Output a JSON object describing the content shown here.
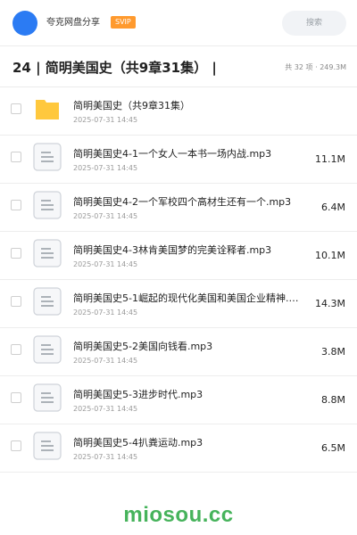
{
  "header": {
    "brand": "夸克网盘分享",
    "badge": "SVIP",
    "search_placeholder": "搜索"
  },
  "title_row": {
    "title": "24 | 简明美国史（共9章31集） |",
    "summary": "共 32 项 · 249.3M"
  },
  "files": [
    {
      "icon": "folder-icon",
      "name": "简明美国史（共9章31集）",
      "date": "2025-07-31 14:45",
      "size": ""
    },
    {
      "icon": "file-audio-icon",
      "name": "简明美国史4-1一个女人一本书一场内战.mp3",
      "date": "2025-07-31 14:45",
      "size": "11.1M"
    },
    {
      "icon": "file-audio-icon",
      "name": "简明美国史4-2一个军校四个高材生还有一个.mp3",
      "date": "2025-07-31 14:45",
      "size": "6.4M"
    },
    {
      "icon": "file-audio-icon",
      "name": "简明美国史4-3林肯美国梦的完美诠释者.mp3",
      "date": "2025-07-31 14:45",
      "size": "10.1M"
    },
    {
      "icon": "file-audio-icon",
      "name": "简明美国史5-1崛起的现代化美国和美国企业精神.m…",
      "date": "2025-07-31 14:45",
      "size": "14.3M"
    },
    {
      "icon": "file-audio-icon",
      "name": "简明美国史5-2美国向钱看.mp3",
      "date": "2025-07-31 14:45",
      "size": "3.8M"
    },
    {
      "icon": "file-audio-icon",
      "name": "简明美国史5-3进步时代.mp3",
      "date": "2025-07-31 14:45",
      "size": "8.8M"
    },
    {
      "icon": "file-audio-icon",
      "name": "简明美国史5-4扒粪运动.mp3",
      "date": "2025-07-31 14:45",
      "size": "6.5M"
    }
  ],
  "footer": {
    "watermark": "miosou.cc"
  },
  "colors": {
    "avatar": "#2b7bf3",
    "svip": "#ff9a2e",
    "folder": "#ffc83d",
    "watermark": "#46b35b"
  }
}
